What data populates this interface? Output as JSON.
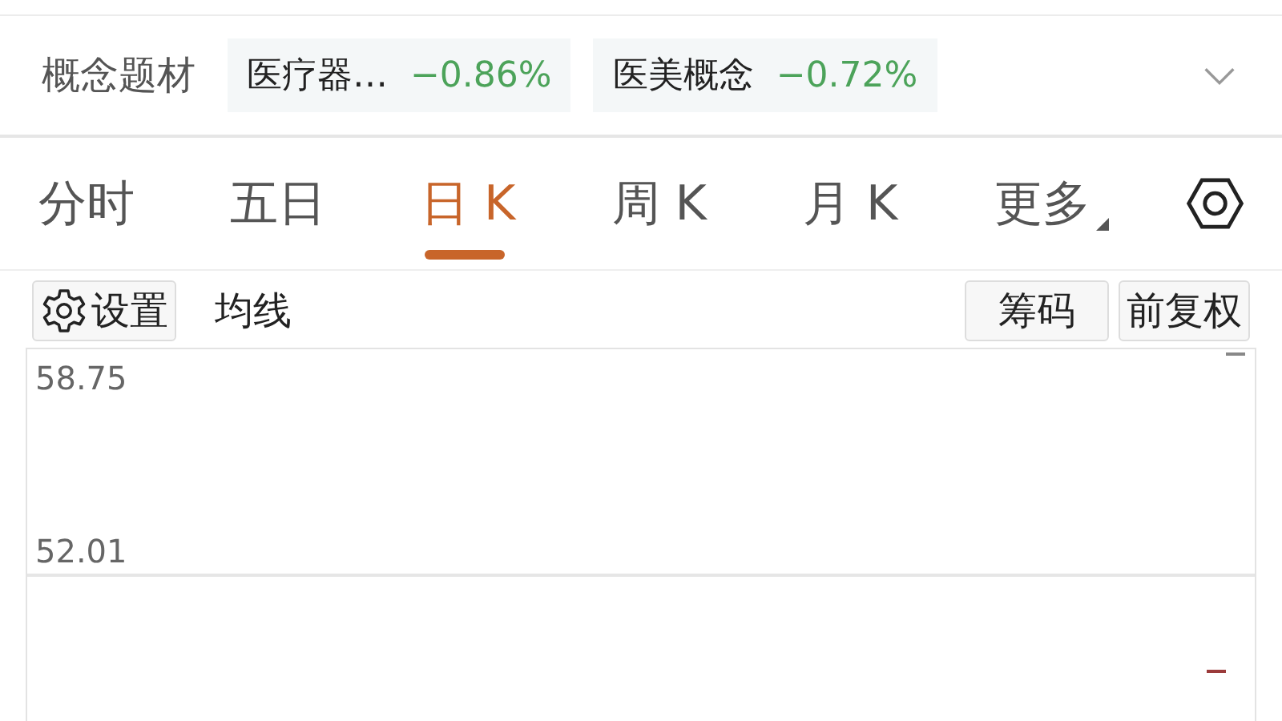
{
  "concept_bar": {
    "label": "概念题材",
    "tags": [
      {
        "name": "医疗器…",
        "change": "−0.86%"
      },
      {
        "name": "医美概念",
        "change": "−0.72%"
      }
    ]
  },
  "tabs": [
    {
      "label": "分时",
      "selected": false,
      "dropdown": false
    },
    {
      "label": "五日",
      "selected": false,
      "dropdown": false
    },
    {
      "label": "日 K",
      "selected": true,
      "dropdown": false
    },
    {
      "label": "周 K",
      "selected": false,
      "dropdown": false
    },
    {
      "label": "月 K",
      "selected": false,
      "dropdown": false
    },
    {
      "label": "更多",
      "selected": false,
      "dropdown": true
    }
  ],
  "toolbar": {
    "settings": "设置",
    "ma": "均线",
    "chips": "筹码",
    "adjust": "前复权"
  },
  "chart": {
    "price_high": "58.75",
    "price_low": "52.01"
  }
}
